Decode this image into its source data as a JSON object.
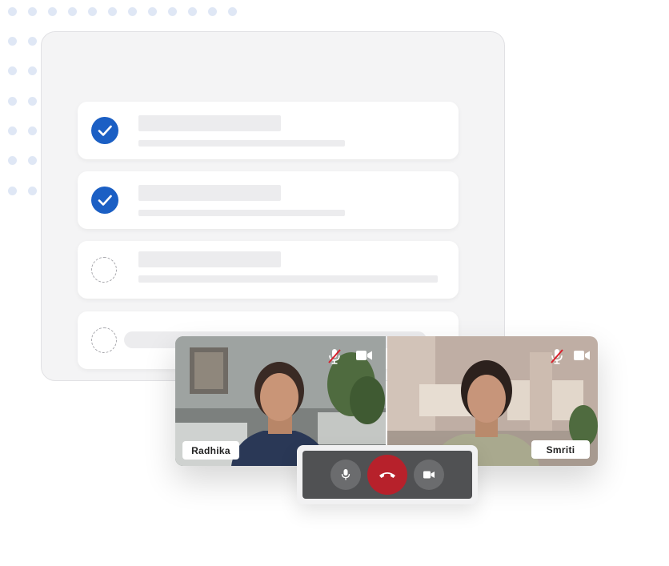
{
  "participants": [
    {
      "name": "Radhika"
    },
    {
      "name": "Smriti"
    }
  ],
  "tasks": [
    {
      "status": "done"
    },
    {
      "status": "done"
    },
    {
      "status": "pending"
    },
    {
      "status": "pending"
    }
  ],
  "icons": {
    "check": "check-icon",
    "mic_muted": "mic-muted-icon",
    "camera": "video-camera-icon",
    "mic": "microphone-icon",
    "end_call": "phone-hangup-icon"
  },
  "colors": {
    "accent": "#1b5fc4",
    "end_call": "#b7212b",
    "control_bar": "#505153",
    "dots": "#dfe7f5"
  }
}
